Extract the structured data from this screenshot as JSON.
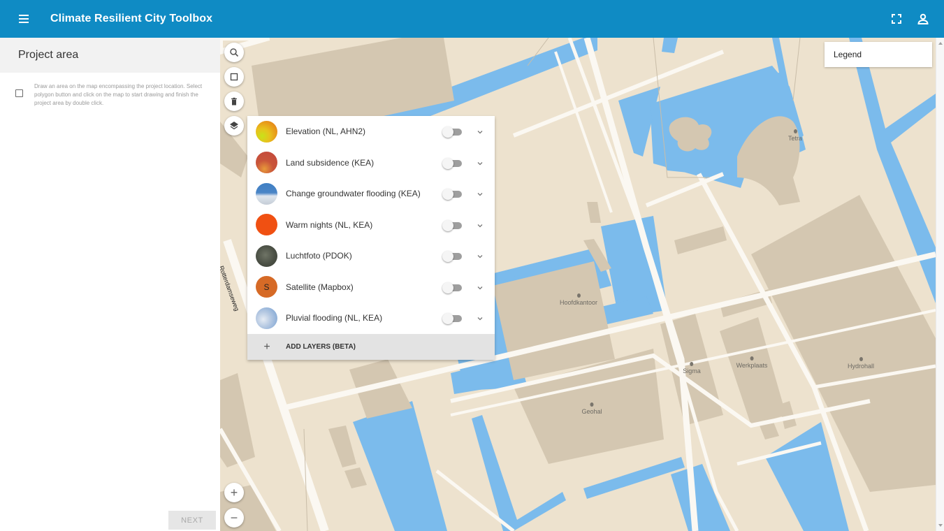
{
  "app": {
    "title": "Climate Resilient City Toolbox"
  },
  "icons": {
    "menu": "menu-icon",
    "fullscreen": "fullscreen-icon",
    "account": "account-icon",
    "search": "search-icon",
    "draw": "square-icon",
    "delete": "trash-icon",
    "layers": "layers-icon",
    "zoom_in": "plus-icon",
    "zoom_out": "minus-icon"
  },
  "sidebar": {
    "title": "Project area",
    "step_text": "Draw an area on the map encompassing the project location. Select polygon button and click on the map to start drawing and finish the project area by double click.",
    "next_label": "NEXT"
  },
  "map": {
    "legend_label": "Legend",
    "street_label": "Rotterdamseweg",
    "pois": [
      {
        "name": "Tetra"
      },
      {
        "name": "Hoofdkantoor"
      },
      {
        "name": "Sigma"
      },
      {
        "name": "Werkplaats"
      },
      {
        "name": "Hydrohall"
      },
      {
        "name": "Geohal"
      }
    ],
    "zoom_in_label": "+",
    "zoom_out_label": "−"
  },
  "layers": {
    "items": [
      {
        "label": "Elevation (NL, AHN2)",
        "enabled": false,
        "thumb": "elevation"
      },
      {
        "label": "Land subsidence (KEA)",
        "enabled": false,
        "thumb": "subsidence"
      },
      {
        "label": "Change groundwater flooding (KEA)",
        "enabled": false,
        "thumb": "groundwater"
      },
      {
        "label": "Warm nights (NL, KEA)",
        "enabled": false,
        "thumb": "warm"
      },
      {
        "label": "Luchtfoto (PDOK)",
        "enabled": false,
        "thumb": "aerial"
      },
      {
        "label": "Satellite (Mapbox)",
        "enabled": false,
        "thumb": "satellite",
        "thumb_letter": "S"
      },
      {
        "label": "Pluvial flooding (NL, KEA)",
        "enabled": false,
        "thumb": "pluvial"
      }
    ],
    "add_label": "ADD LAYERS (BETA)"
  },
  "colors": {
    "appbar": "#0f8bc4",
    "land": "#ede2ce",
    "water": "#7bbbec",
    "building": "#d4c7b1",
    "road": "#fbf8f2"
  }
}
